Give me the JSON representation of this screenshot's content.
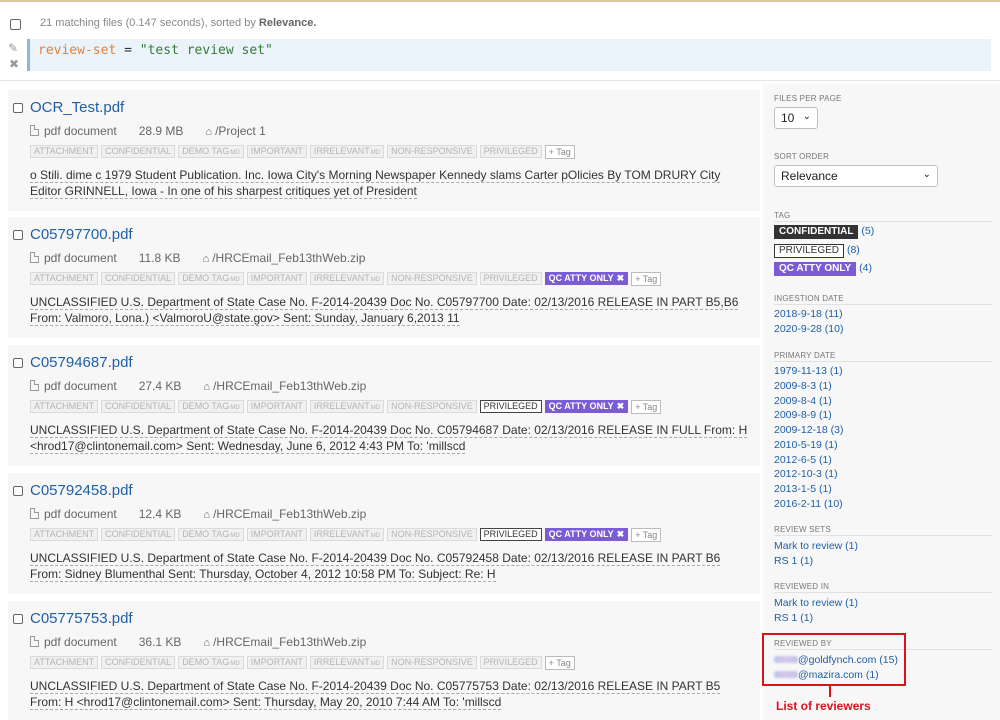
{
  "header": {
    "result_summary": "21 matching files (0.147 seconds), sorted by",
    "sort_name": "Relevance.",
    "query_key": "review-set",
    "query_op": " = ",
    "query_value": "\"test review set\""
  },
  "icons": {
    "edit": "pencil-icon",
    "clear": "close-icon",
    "file": "document-icon",
    "folder": "house-icon"
  },
  "colors": {
    "link": "#1f5fa6",
    "qc_tag": "#7b5cd6",
    "callout": "#d7141c",
    "query_bg": "#eaf3f9"
  },
  "tag_labels": {
    "attachment": "ATTACHMENT",
    "confidential": "CONFIDENTIAL",
    "demo": "DEMO TAG",
    "important": "IMPORTANT",
    "irrelevant": "IRRELEVANT",
    "nonresp": "NON-RESPONSIVE",
    "privileged": "PRIVILEGED",
    "qc": "QC ATTY ONLY",
    "md_badge": "MD",
    "remove": "✖",
    "add": "+ Tag"
  },
  "results": [
    {
      "title": "OCR_Test.pdf",
      "type": "pdf document",
      "size": "28.9 MB",
      "path": "/Project 1",
      "privileged": false,
      "qc": false,
      "snippet": "o Stili. dime c 1979 Student Publication. Inc. Iowa City's Morning Newspaper Kennedy slams Carter pOlicies By TOM DRURY City Editor GRINNELL, Iowa - In one of his sharpest critiques yet of President"
    },
    {
      "title": "C05797700.pdf",
      "type": "pdf document",
      "size": "11.8 KB",
      "path": "/HRCEmail_Feb13thWeb.zip",
      "privileged": false,
      "qc": true,
      "snippet": "UNCLASSIFIED U.S. Department of State Case No. F-2014-20439 Doc No. C05797700 Date: 02/13/2016 RELEASE IN PART B5,B6 From: Valmoro, Lona.) <ValmoroU@state.gov> Sent: Sunday, January 6,2013 11"
    },
    {
      "title": "C05794687.pdf",
      "type": "pdf document",
      "size": "27.4 KB",
      "path": "/HRCEmail_Feb13thWeb.zip",
      "privileged": true,
      "qc": true,
      "snippet": "UNCLASSIFIED U.S. Department of State Case No. F-2014-20439 Doc No. C05794687 Date: 02/13/2016 RELEASE IN FULL From: H <hrod17@clintonemail.com> Sent: Wednesday, June 6, 2012 4:43 PM To: 'millscd"
    },
    {
      "title": "C05792458.pdf",
      "type": "pdf document",
      "size": "12.4 KB",
      "path": "/HRCEmail_Feb13thWeb.zip",
      "privileged": true,
      "qc": true,
      "snippet": "UNCLASSIFIED U.S. Department of State Case No. F-2014-20439 Doc No. C05792458 Date: 02/13/2016 RELEASE IN PART B6 From: Sidney Blumenthal Sent: Thursday, October 4, 2012 10:58 PM To: Subject: Re: H"
    },
    {
      "title": "C05775753.pdf",
      "type": "pdf document",
      "size": "36.1 KB",
      "path": "/HRCEmail_Feb13thWeb.zip",
      "privileged": false,
      "qc": false,
      "snippet": "UNCLASSIFIED U.S. Department of State Case No. F-2014-20439 Doc No. C05775753 Date: 02/13/2016 RELEASE IN PART B5 From: H <hrod17@clintonemail.com> Sent: Thursday, May 20, 2010 7:44 AM To: 'millscd"
    }
  ],
  "sidebar": {
    "files_per_page_label": "FILES PER PAGE",
    "files_per_page_value": "10",
    "sort_order_label": "SORT ORDER",
    "sort_order_value": "Relevance",
    "tag_label": "TAG",
    "tag_facets": [
      {
        "label": "CONFIDENTIAL",
        "count": "(5)"
      },
      {
        "label": "PRIVILEGED",
        "count": "(8)"
      },
      {
        "label": "QC ATTY ONLY",
        "count": "(4)"
      }
    ],
    "ingestion_label": "INGESTION DATE",
    "ingestion_dates": [
      "2018-9-18 (11)",
      "2020-9-28 (10)"
    ],
    "primary_label": "PRIMARY DATE",
    "primary_dates": [
      "1979-11-13 (1)",
      "2009-8-3 (1)",
      "2009-8-4 (1)",
      "2009-8-9 (1)",
      "2009-12-18 (3)",
      "2010-5-19 (1)",
      "2012-6-5 (1)",
      "2012-10-3 (1)",
      "2013-1-5 (1)",
      "2016-2-11 (10)"
    ],
    "review_sets_label": "REVIEW SETS",
    "review_sets": [
      "Mark to review (1)",
      "RS 1 (1)"
    ],
    "reviewed_in_label": "REVIEWED IN",
    "reviewed_in": [
      "Mark to review (1)",
      "RS 1 (1)"
    ],
    "reviewed_by_label": "REVIEWED BY",
    "reviewed_by": [
      "@goldfynch.com (15)",
      "@mazira.com (1)"
    ]
  },
  "annotation": {
    "callout": "List of reviewers"
  }
}
